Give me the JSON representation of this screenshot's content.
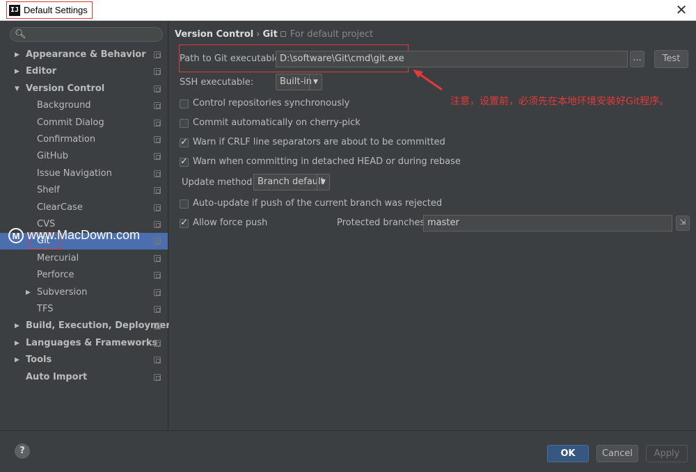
{
  "window": {
    "title": "Default Settings",
    "close_glyph": "✕"
  },
  "sidebar": {
    "search_placeholder": "",
    "items": [
      {
        "label": "Appearance & Behavior",
        "level": 0,
        "expanded": false,
        "bold": true
      },
      {
        "label": "Editor",
        "level": 0,
        "expanded": false,
        "bold": true
      },
      {
        "label": "Version Control",
        "level": 0,
        "expanded": true,
        "bold": true
      },
      {
        "label": "Background",
        "level": 1
      },
      {
        "label": "Commit Dialog",
        "level": 1
      },
      {
        "label": "Confirmation",
        "level": 1
      },
      {
        "label": "GitHub",
        "level": 1
      },
      {
        "label": "Issue Navigation",
        "level": 1
      },
      {
        "label": "Shelf",
        "level": 1
      },
      {
        "label": "ClearCase",
        "level": 1
      },
      {
        "label": "CVS",
        "level": 1
      },
      {
        "label": "Git",
        "level": 1,
        "selected": true
      },
      {
        "label": "Mercurial",
        "level": 1
      },
      {
        "label": "Perforce",
        "level": 1
      },
      {
        "label": "Subversion",
        "level": 1,
        "expanded": false
      },
      {
        "label": "TFS",
        "level": 1
      },
      {
        "label": "Build, Execution, Deployment",
        "level": 0,
        "expanded": false,
        "bold": true
      },
      {
        "label": "Languages & Frameworks",
        "level": 0,
        "expanded": false,
        "bold": true
      },
      {
        "label": "Tools",
        "level": 0,
        "expanded": false,
        "bold": true
      },
      {
        "label": "Auto Import",
        "level": 0,
        "bold": true
      }
    ]
  },
  "watermark": {
    "logo": "M",
    "text": "www.MacDown.com"
  },
  "breadcrumb": {
    "parent": "Version Control",
    "separator": "›",
    "current": "Git",
    "scope": "For default project"
  },
  "git": {
    "path_label": "Path to Git executable:",
    "path_value": "D:\\software\\Git\\cmd\\git.exe",
    "browse_label": "...",
    "test_label": "Test",
    "ssh_label": "SSH executable:",
    "ssh_value": "Built-in",
    "options": [
      {
        "label": "Control repositories synchronously",
        "checked": false
      },
      {
        "label": "Commit automatically on cherry-pick",
        "checked": false
      },
      {
        "label": "Warn if CRLF line separators are about to be committed",
        "checked": true
      },
      {
        "label": "Warn when committing in detached HEAD or during rebase",
        "checked": true
      }
    ],
    "update_method_label": "Update method:",
    "update_method_value": "Branch default",
    "auto_update_label": "Auto-update if push of the current branch was rejected",
    "auto_update_checked": false,
    "allow_force_push_label": "Allow force push",
    "allow_force_push_checked": true,
    "protected_branches_label": "Protected branches:",
    "protected_branches_value": "master"
  },
  "annotation": {
    "text": "注意，设置前，必须先在本地环境安装好Git程序。",
    "color": "#e23a3a"
  },
  "footer": {
    "help_label": "?",
    "ok_label": "OK",
    "cancel_label": "Cancel",
    "apply_label": "Apply"
  },
  "colors": {
    "background": "#3c3f41",
    "selection": "#4b6eaf",
    "annotation": "#e23a3a"
  }
}
